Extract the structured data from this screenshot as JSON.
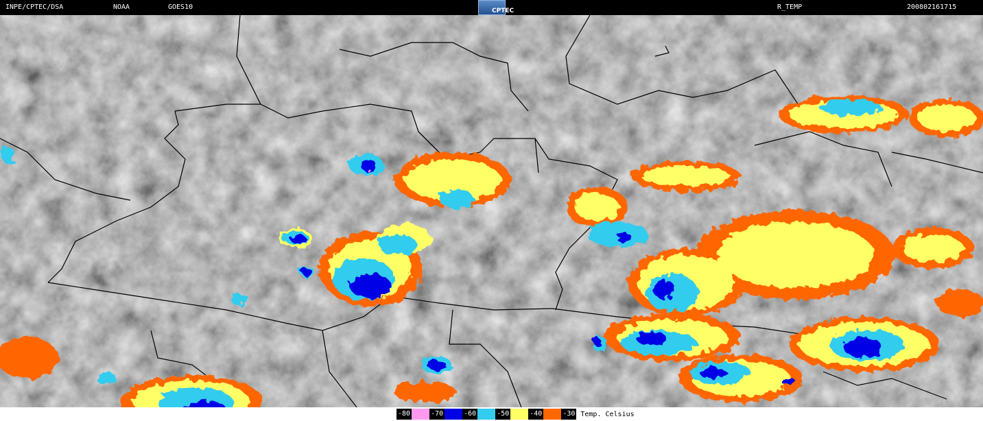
{
  "header": {
    "agency": "INPE/CPTEC/DSA",
    "source": "NOAA",
    "satellite": "GOES10",
    "logo_text": "CPTEC",
    "product": "R_TEMP",
    "timestamp": "200802161715"
  },
  "legend": {
    "unit": "Temp. Celsius",
    "steps": [
      {
        "label": "-80",
        "color": "#ff99ee"
      },
      {
        "label": "-70",
        "color": "#0000e6"
      },
      {
        "label": "-60",
        "color": "#33ccee"
      },
      {
        "label": "-50",
        "color": "#ffff66"
      },
      {
        "label": "-40",
        "color": "#ff6600"
      },
      {
        "label": "-30",
        "color": ""
      }
    ]
  },
  "colors": {
    "background": "#000000",
    "cloud_gray": "#6e6e6e",
    "border_lines": "#000000"
  }
}
